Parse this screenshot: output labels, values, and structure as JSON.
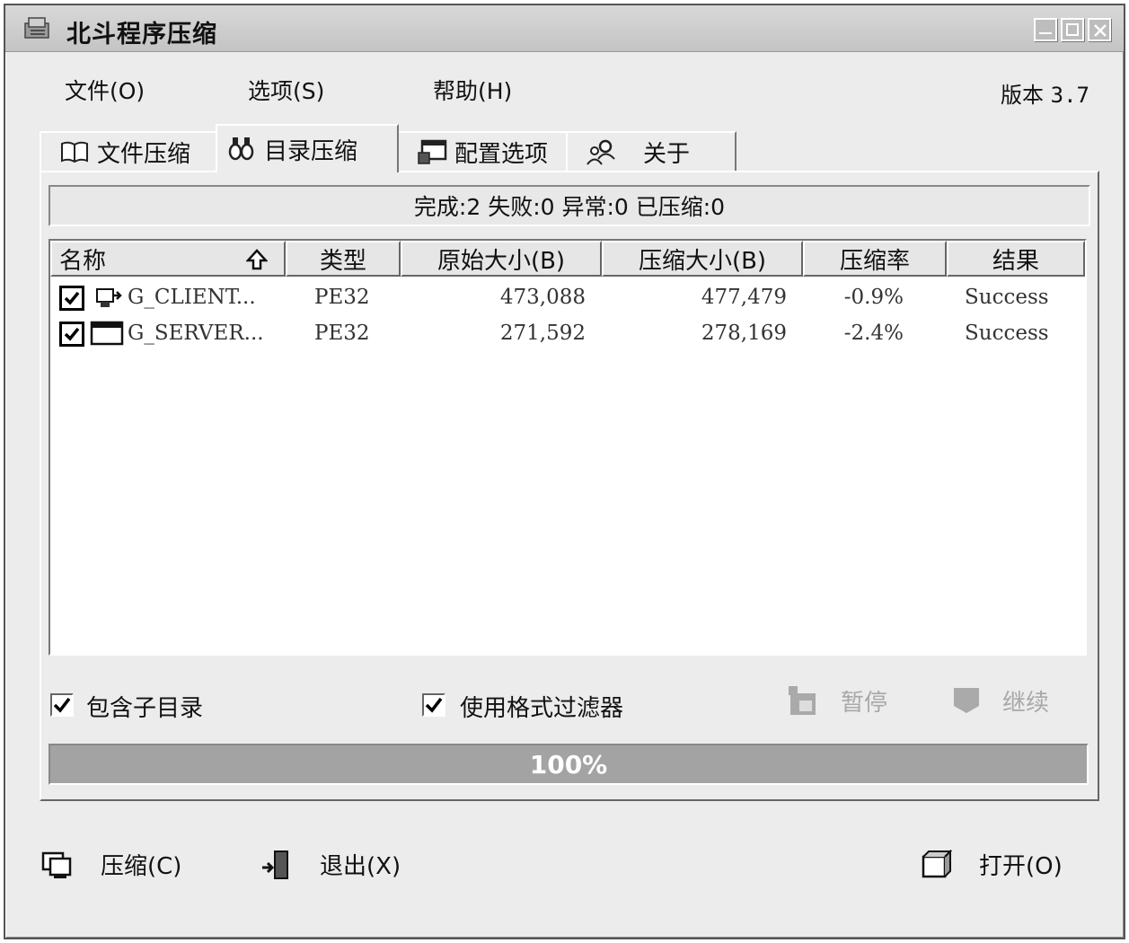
{
  "window": {
    "title": "北斗程序压缩",
    "icon": "app-compress-icon"
  },
  "menu": {
    "items": [
      "文件(O)",
      "选项(S)",
      "帮助(H)"
    ],
    "version_label": "版本",
    "version_number": "3.7"
  },
  "tabs": [
    {
      "label": "文件压缩",
      "icon": "book-icon",
      "active": false
    },
    {
      "label": "目录压缩",
      "icon": "binoculars-icon",
      "active": true
    },
    {
      "label": "配置选项",
      "icon": "config-window-icon",
      "active": false
    },
    {
      "label": "关于",
      "icon": "users-icon",
      "active": false
    }
  ],
  "status": {
    "text": "完成:2 失败:0 异常:0 已压缩:0"
  },
  "table": {
    "columns": [
      "名称",
      "类型",
      "原始大小(B)",
      "压缩大小(B)",
      "压缩率",
      "结果"
    ],
    "sort_icon": "sort-up-arrow-icon",
    "rows": [
      {
        "checked": true,
        "icon": "network-exe-icon",
        "name": "G_CLIENT...",
        "type": "PE32",
        "original": "473,088",
        "compressed": "477,479",
        "ratio": "-0.9%",
        "result": "Success"
      },
      {
        "checked": true,
        "icon": "window-exe-icon",
        "name": "G_SERVER...",
        "type": "PE32",
        "original": "271,592",
        "compressed": "278,169",
        "ratio": "-2.4%",
        "result": "Success"
      }
    ]
  },
  "options": {
    "include_subdirs": {
      "label": "包含子目录",
      "checked": true
    },
    "use_filter": {
      "label": "使用格式过滤器",
      "checked": true
    },
    "pause_label": "暂停",
    "resume_label": "继续"
  },
  "progress": {
    "value": 1.0,
    "text": "100%"
  },
  "buttons": {
    "compress": "压缩(C)",
    "exit": "退出(X)",
    "open": "打开(O)"
  }
}
